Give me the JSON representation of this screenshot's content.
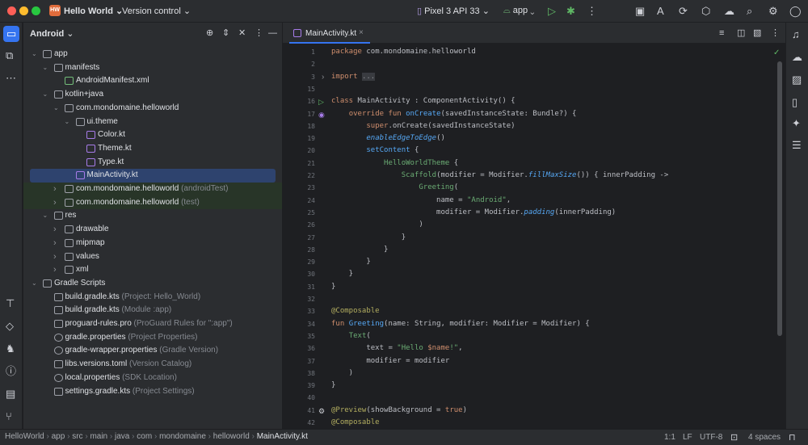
{
  "titlebar": {
    "project_badge": "HW",
    "project": "Hello World",
    "vcs": "Version control",
    "device": "Pixel 3 API 33",
    "run_config": "app"
  },
  "project_panel": {
    "title": "Android",
    "items": [
      {
        "label": "app",
        "sub": "",
        "depth": 0,
        "arrow": "v",
        "icon": "folder"
      },
      {
        "label": "manifests",
        "sub": "",
        "depth": 1,
        "arrow": "v",
        "icon": "folder"
      },
      {
        "label": "AndroidManifest.xml",
        "sub": "",
        "depth": 2,
        "arrow": "",
        "icon": "xml"
      },
      {
        "label": "kotlin+java",
        "sub": "",
        "depth": 1,
        "arrow": "v",
        "icon": "folder"
      },
      {
        "label": "com.mondomaine.helloworld",
        "sub": "",
        "depth": 2,
        "arrow": "v",
        "icon": "folder"
      },
      {
        "label": "ui.theme",
        "sub": "",
        "depth": 3,
        "arrow": "v",
        "icon": "folder"
      },
      {
        "label": "Color.kt",
        "sub": "",
        "depth": 4,
        "arrow": "",
        "icon": "kotlin"
      },
      {
        "label": "Theme.kt",
        "sub": "",
        "depth": 4,
        "arrow": "",
        "icon": "kotlin"
      },
      {
        "label": "Type.kt",
        "sub": "",
        "depth": 4,
        "arrow": "",
        "icon": "kotlin"
      },
      {
        "label": "MainActivity.kt",
        "sub": "",
        "depth": 3,
        "arrow": "",
        "icon": "kotlin",
        "selected": true
      },
      {
        "label": "com.mondomaine.helloworld",
        "sub": "(androidTest)",
        "depth": 2,
        "arrow": ">",
        "icon": "folder",
        "green": true
      },
      {
        "label": "com.mondomaine.helloworld",
        "sub": "(test)",
        "depth": 2,
        "arrow": ">",
        "icon": "folder",
        "green": true
      },
      {
        "label": "res",
        "sub": "",
        "depth": 1,
        "arrow": "v",
        "icon": "folder"
      },
      {
        "label": "drawable",
        "sub": "",
        "depth": 2,
        "arrow": ">",
        "icon": "folder"
      },
      {
        "label": "mipmap",
        "sub": "",
        "depth": 2,
        "arrow": ">",
        "icon": "folder"
      },
      {
        "label": "values",
        "sub": "",
        "depth": 2,
        "arrow": ">",
        "icon": "folder"
      },
      {
        "label": "xml",
        "sub": "",
        "depth": 2,
        "arrow": ">",
        "icon": "folder"
      },
      {
        "label": "Gradle Scripts",
        "sub": "",
        "depth": 0,
        "arrow": "v",
        "icon": "gradle"
      },
      {
        "label": "build.gradle.kts",
        "sub": "(Project: Hello_World)",
        "depth": 1,
        "arrow": "",
        "icon": "gradle"
      },
      {
        "label": "build.gradle.kts",
        "sub": "(Module :app)",
        "depth": 1,
        "arrow": "",
        "icon": "gradle"
      },
      {
        "label": "proguard-rules.pro",
        "sub": "(ProGuard Rules for \":app\")",
        "depth": 1,
        "arrow": "",
        "icon": "file"
      },
      {
        "label": "gradle.properties",
        "sub": "(Project Properties)",
        "depth": 1,
        "arrow": "",
        "icon": "gear"
      },
      {
        "label": "gradle-wrapper.properties",
        "sub": "(Gradle Version)",
        "depth": 1,
        "arrow": "",
        "icon": "gear"
      },
      {
        "label": "libs.versions.toml",
        "sub": "(Version Catalog)",
        "depth": 1,
        "arrow": "",
        "icon": "file"
      },
      {
        "label": "local.properties",
        "sub": "(SDK Location)",
        "depth": 1,
        "arrow": "",
        "icon": "gear"
      },
      {
        "label": "settings.gradle.kts",
        "sub": "(Project Settings)",
        "depth": 1,
        "arrow": "",
        "icon": "gradle"
      }
    ]
  },
  "editor": {
    "tab": "MainActivity.kt",
    "lines": [
      {
        "n": "1",
        "html": "<span class='kw'>package</span> com.mondomaine.helloworld"
      },
      {
        "n": "2",
        "html": ""
      },
      {
        "n": "3",
        "html": "<span class='kw'>import</span> <span style='background:#393b40;color:#8c8f94'>...</span>"
      },
      {
        "n": "15",
        "html": ""
      },
      {
        "n": "16",
        "html": "<span class='kw'>class</span> MainActivity : ComponentActivity() {"
      },
      {
        "n": "17",
        "html": "    <span class='kw'>override fun</span> <span class='fn'>onCreate</span>(savedInstanceState: Bundle?) {"
      },
      {
        "n": "18",
        "html": "        <span class='kw'>super</span>.onCreate(savedInstanceState)"
      },
      {
        "n": "19",
        "html": "        <span class='fn it'>enableEdgeToEdge</span>()"
      },
      {
        "n": "20",
        "html": "        <span class='fn'>setContent</span> {"
      },
      {
        "n": "21",
        "html": "            <span class='str' style='color:#6aab73'>HelloWorldTheme</span> {"
      },
      {
        "n": "22",
        "html": "                <span class='str'>Scaffold</span>(modifier = Modifier.<span class='fn it'>fillMaxSize</span>()) { innerPadding ->"
      },
      {
        "n": "23",
        "html": "                    <span class='str'>Greeting</span>("
      },
      {
        "n": "24",
        "html": "                        name = <span class='str'>\"Android\"</span>,"
      },
      {
        "n": "25",
        "html": "                        modifier = Modifier.<span class='fn it'>padding</span>(innerPadding)"
      },
      {
        "n": "26",
        "html": "                    )"
      },
      {
        "n": "27",
        "html": "                }"
      },
      {
        "n": "28",
        "html": "            }"
      },
      {
        "n": "29",
        "html": "        }"
      },
      {
        "n": "30",
        "html": "    }"
      },
      {
        "n": "31",
        "html": "}"
      },
      {
        "n": "32",
        "html": ""
      },
      {
        "n": "33",
        "html": "<span class='an'>@Composable</span>"
      },
      {
        "n": "34",
        "html": "<span class='kw'>fun</span> <span class='fn'>Greeting</span>(name: String, modifier: Modifier = Modifier) {"
      },
      {
        "n": "35",
        "html": "    <span class='str'>Text</span>("
      },
      {
        "n": "36",
        "html": "        text = <span class='str'>\"Hello <span class='kw'>$name</span>!\"</span>,"
      },
      {
        "n": "37",
        "html": "        modifier = modifier"
      },
      {
        "n": "38",
        "html": "    )"
      },
      {
        "n": "39",
        "html": "}"
      },
      {
        "n": "40",
        "html": ""
      },
      {
        "n": "41",
        "html": "<span class='an'>@Preview</span>(showBackground = <span class='kw'>true</span>)"
      },
      {
        "n": "42",
        "html": "<span class='an'>@Composable</span>"
      }
    ]
  },
  "statusbar": {
    "crumbs": [
      "HelloWorld",
      "app",
      "src",
      "main",
      "java",
      "com",
      "mondomaine",
      "helloworld",
      "MainActivity.kt"
    ],
    "position": "1:1",
    "line_sep": "LF",
    "encoding": "UTF-8",
    "indent": "4 spaces"
  }
}
